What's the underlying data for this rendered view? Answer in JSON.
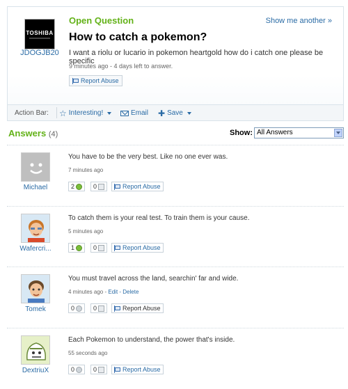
{
  "question": {
    "label": "Open Question",
    "show_another": "Show me another »",
    "asker_name": "JDOGJB20",
    "asker_avatar_logo": "TOSHIBA",
    "title": "How to catch a pokemon?",
    "body": "I want a riolu or lucario in pokemon heartgold how do i catch one please be specific",
    "meta": "9 minutes ago - 4 days left to answer.",
    "report_label": "Report Abuse"
  },
  "action_bar": {
    "label": "Action Bar:",
    "interesting": "Interesting!",
    "email": "Email",
    "save": "Save"
  },
  "answers_header": {
    "title": "Answers",
    "count": "(4)",
    "show_label": "Show:",
    "filter_selected": "All Answers"
  },
  "answers": [
    {
      "name": "Michael",
      "text": "You have to be the very best. Like no one ever was.",
      "meta": "7 minutes ago",
      "meta_links": "",
      "thumbs_up": "2",
      "thumbs_down": "0",
      "report": "Report Abuse"
    },
    {
      "name": "Wafercri...",
      "text": "To catch them is your real test. To train them is your cause.",
      "meta": "5 minutes ago",
      "meta_links": "",
      "thumbs_up": "1",
      "thumbs_down": "0",
      "report": "Report Abuse"
    },
    {
      "name": "Tomek",
      "text": "You must travel across the land, searchin' far and wide.",
      "meta": "4 minutes ago - ",
      "meta_links": "Edit - Delete",
      "thumbs_up": "0",
      "thumbs_down": "0",
      "report": "Report Abuse"
    },
    {
      "name": "DextriuX",
      "text": "Each Pokemon to understand, the power that's inside.",
      "meta": "55 seconds ago",
      "meta_links": "",
      "thumbs_up": "0",
      "thumbs_down": "0",
      "report": "Report Abuse"
    }
  ],
  "colors": {
    "accent_green": "#63b218",
    "link_blue": "#2a6ba5"
  }
}
